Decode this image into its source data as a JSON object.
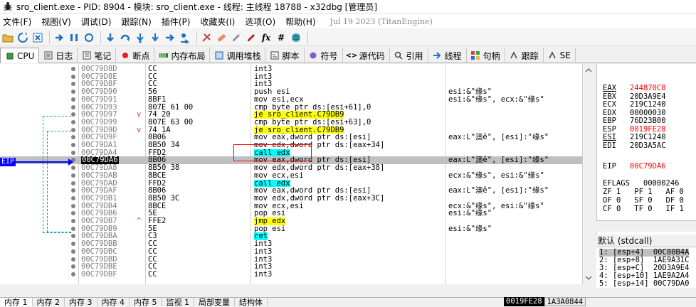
{
  "window": {
    "title": "sro_client.exe - PID: 8904 - 模块: sro_client.exe - 线程: 主线程 18788 - x32dbg [管理员]"
  },
  "menu": {
    "items": [
      "文件(F)",
      "视图(V)",
      "调试(D)",
      "跟踪(N)",
      "插件(P)",
      "收藏夹(I)",
      "选项(O)",
      "帮助(H)"
    ],
    "build_date": "Jul 19 2023 (TitanEngine)"
  },
  "tabs": [
    {
      "label": "CPU",
      "icon": "cpu-icon"
    },
    {
      "label": "日志",
      "icon": "log-icon"
    },
    {
      "label": "笔记",
      "icon": "notes-icon"
    },
    {
      "label": "断点",
      "icon": "breakpoint-icon"
    },
    {
      "label": "内存布局",
      "icon": "memory-map-icon"
    },
    {
      "label": "调用堆栈",
      "icon": "call-stack-icon"
    },
    {
      "label": "脚本",
      "icon": "script-icon"
    },
    {
      "label": "符号",
      "icon": "symbols-icon"
    },
    {
      "label": "源代码",
      "icon": "source-icon"
    },
    {
      "label": "引用",
      "icon": "references-icon"
    },
    {
      "label": "线程",
      "icon": "threads-icon"
    },
    {
      "label": "句柄",
      "icon": "handles-icon"
    },
    {
      "label": "跟踪",
      "icon": "trace-icon"
    },
    {
      "label": "SE",
      "icon": "seh-icon"
    }
  ],
  "disasm": {
    "eip_label": "EIP",
    "rows": [
      {
        "addr": "00C79D8D",
        "bytes": "CC",
        "ins": "int3",
        "cmt": ""
      },
      {
        "addr": "00C79D8E",
        "bytes": "CC",
        "ins": "int3",
        "cmt": ""
      },
      {
        "addr": "00C79D8F",
        "bytes": "CC",
        "ins": "int3",
        "cmt": ""
      },
      {
        "addr": "00C79D90",
        "bytes": "56",
        "ins": "push esi",
        "cmt": "esi:&\"缘s\""
      },
      {
        "addr": "00C79D91",
        "bytes": "8BF1",
        "ins": "mov esi,ecx",
        "cmt": "esi:&\"缘s\", ecx:&\"缘s\""
      },
      {
        "addr": "00C79D93",
        "bytes": "807E 61 00",
        "ins": "cmp byte ptr ds:[esi+61],0",
        "cmt": ""
      },
      {
        "addr": "00C79D97",
        "bytes": "74 20",
        "ins": "je sro_client.C79DB9",
        "cmt": "",
        "hl": "yellow",
        "mark": "v"
      },
      {
        "addr": "00C79D99",
        "bytes": "807E 63 00",
        "ins": "cmp byte ptr ds:[esi+63],0",
        "cmt": ""
      },
      {
        "addr": "00C79D9D",
        "bytes": "74 1A",
        "ins": "je sro_client.C79DB9",
        "cmt": "",
        "hl": "yellow",
        "mark": "v"
      },
      {
        "addr": "00C79D9F",
        "bytes": "8B06",
        "ins": "mov eax,dword ptr ds:[esi]",
        "cmt": "eax:L\"澳ê\", [esi]:\"缘s\""
      },
      {
        "addr": "00C79DA1",
        "bytes": "8B50 34",
        "ins": "mov edx,dword ptr ds:[eax+34]",
        "cmt": ""
      },
      {
        "addr": "00C79DA4",
        "bytes": "FFD2",
        "ins": "call edx",
        "cmt": "",
        "hl": "cyan"
      },
      {
        "addr": "00C79DA6",
        "bytes": "8B06",
        "ins": "mov eax,dword ptr ds:[esi]",
        "cmt": "eax:L\"澳ê\", [esi]:\"缘s\"",
        "sel": true
      },
      {
        "addr": "00C79DA8",
        "bytes": "8B50 38",
        "ins": "mov edx,dword ptr ds:[eax+38]",
        "cmt": ""
      },
      {
        "addr": "00C79DAB",
        "bytes": "8BCE",
        "ins": "mov ecx,esi",
        "cmt": "ecx:&\"缘s\", esi:&\"缘s\""
      },
      {
        "addr": "00C79DAD",
        "bytes": "FFD2",
        "ins": "call edx",
        "cmt": "",
        "hl": "cyan"
      },
      {
        "addr": "00C79DAF",
        "bytes": "8B06",
        "ins": "mov eax,dword ptr ds:[esi]",
        "cmt": "eax:L\"澳ê\", [esi]:\"缘s\""
      },
      {
        "addr": "00C79DB1",
        "bytes": "8B50 3C",
        "ins": "mov edx,dword ptr ds:[eax+3C]",
        "cmt": ""
      },
      {
        "addr": "00C79DB4",
        "bytes": "8BCE",
        "ins": "mov ecx,esi",
        "cmt": "ecx:&\"缘s\", esi:&\"缘s\""
      },
      {
        "addr": "00C79DB6",
        "bytes": "5E",
        "ins": "pop esi",
        "cmt": "esi:&\"缘s\""
      },
      {
        "addr": "00C79DB7",
        "bytes": "FFE2",
        "ins": "jmp edx",
        "cmt": "",
        "hl": "yellow",
        "mark": "^"
      },
      {
        "addr": "00C79DB9",
        "bytes": "5E",
        "ins": "pop esi",
        "cmt": "esi:&\"缘s\""
      },
      {
        "addr": "00C79DBA",
        "bytes": "C3",
        "ins": "ret",
        "cmt": "",
        "hl": "cyan"
      },
      {
        "addr": "00C79DBB",
        "bytes": "CC",
        "ins": "int3",
        "cmt": ""
      },
      {
        "addr": "00C79DBC",
        "bytes": "CC",
        "ins": "int3",
        "cmt": ""
      },
      {
        "addr": "00C79DBD",
        "bytes": "CC",
        "ins": "int3",
        "cmt": ""
      },
      {
        "addr": "00C79DBE",
        "bytes": "CC",
        "ins": "int3",
        "cmt": ""
      },
      {
        "addr": "00C79DBF",
        "bytes": "CC",
        "ins": "int3",
        "cmt": ""
      }
    ]
  },
  "registers": {
    "rows": [
      {
        "name": "EAX",
        "value": "244870C8",
        "changed": true
      },
      {
        "name": "EBX",
        "value": "20D3A9E4",
        "changed": false
      },
      {
        "name": "ECX",
        "value": "219C1240",
        "changed": false
      },
      {
        "name": "EDX",
        "value": "00000030",
        "changed": false
      },
      {
        "name": "EBP",
        "value": "76D23B00",
        "changed": false
      },
      {
        "name": "ESP",
        "value": "0019FE28",
        "changed": true
      },
      {
        "name": "ESI",
        "value": "219C1240",
        "changed": false
      },
      {
        "name": "EDI",
        "value": "20D3A5AC",
        "changed": false
      }
    ],
    "eip": {
      "name": "EIP",
      "value": "00C79DA6"
    },
    "eflags": {
      "name": "EFLAGS",
      "value": "00000246"
    },
    "flags": [
      "ZF 1   PF 1   AF 0",
      "OF 0   SF 0   DF 0",
      "CF 0   TF 0   IF 1"
    ]
  },
  "call_conv": "默认 (stdcall)",
  "stack_args": [
    "1: [esp+4]  00C80B4A",
    "2: [esp+8]  1AE9A31C",
    "3: [esp+C]  20D3A9E4",
    "4: [esp+10] 1AE9A2A4",
    "5: [esp+14] 00C79DA0"
  ],
  "bottom_tabs": [
    "内存 1",
    "内存 2",
    "内存 3",
    "内存 4",
    "内存 5",
    "监视 1",
    "局部变量",
    "结构体"
  ],
  "status": {
    "addr1": "0019FE28",
    "addr2": "1A3A0844"
  }
}
